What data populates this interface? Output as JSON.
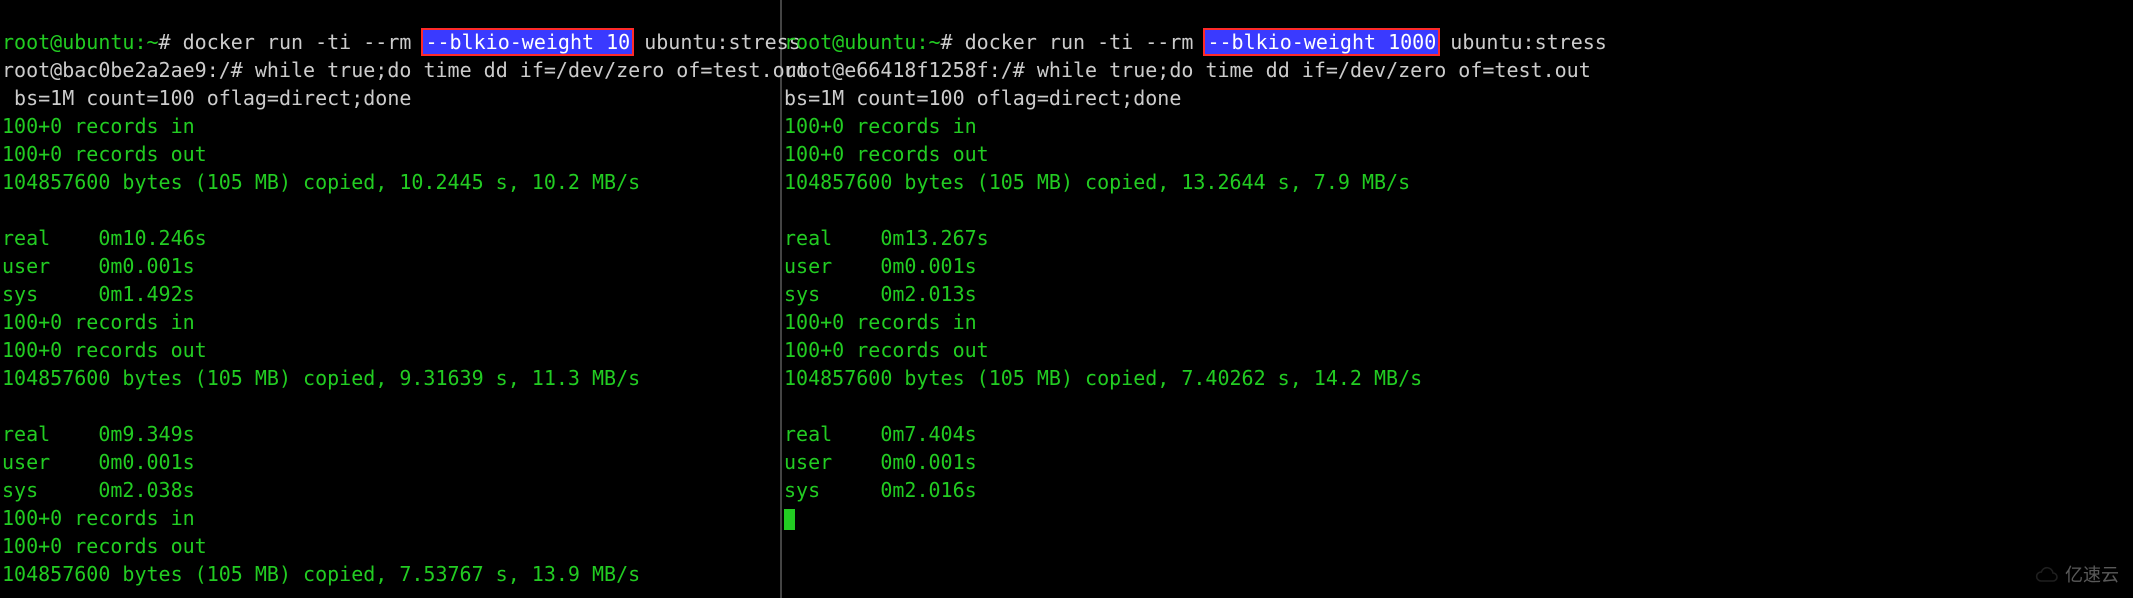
{
  "left": {
    "prompt_host": "root@ubuntu",
    "prompt_path": "~",
    "docker_pre": "docker run -ti --rm ",
    "docker_flag": "--blkio-weight 10",
    "docker_post": " ubuntu:stress",
    "inner_prompt": "root@bac0be2a2ae9:/# ",
    "inner_cmd": "while true;do time dd if=/dev/zero of=test.out\n bs=1M count=100 oflag=direct;done",
    "runs": [
      {
        "rec_in": "100+0 records in",
        "rec_out": "100+0 records out",
        "copied": "104857600 bytes (105 MB) copied, 10.2445 s, 10.2 MB/s",
        "real": "real    0m10.246s",
        "user": "user    0m0.001s",
        "sys": "sys     0m1.492s"
      },
      {
        "rec_in": "100+0 records in",
        "rec_out": "100+0 records out",
        "copied": "104857600 bytes (105 MB) copied, 9.31639 s, 11.3 MB/s",
        "real": "real    0m9.349s",
        "user": "user    0m0.001s",
        "sys": "sys     0m2.038s"
      },
      {
        "rec_in": "100+0 records in",
        "rec_out": "100+0 records out",
        "copied": "104857600 bytes (105 MB) copied, 7.53767 s, 13.9 MB/s"
      }
    ]
  },
  "right": {
    "prompt_host": "root@ubuntu",
    "prompt_path": "~",
    "docker_pre": "docker run -ti --rm ",
    "docker_flag": "--blkio-weight 1000",
    "docker_post": " ubuntu:stress",
    "inner_prompt": "root@e66418f1258f:/# ",
    "inner_cmd": "while true;do time dd if=/dev/zero of=test.out\nbs=1M count=100 oflag=direct;done",
    "runs": [
      {
        "rec_in": "100+0 records in",
        "rec_out": "100+0 records out",
        "copied": "104857600 bytes (105 MB) copied, 13.2644 s, 7.9 MB/s",
        "real": "real    0m13.267s",
        "user": "user    0m0.001s",
        "sys": "sys     0m2.013s"
      },
      {
        "rec_in": "100+0 records in",
        "rec_out": "100+0 records out",
        "copied": "104857600 bytes (105 MB) copied, 7.40262 s, 14.2 MB/s",
        "real": "real    0m7.404s",
        "user": "user    0m0.001s",
        "sys": "sys     0m2.016s"
      }
    ]
  },
  "watermark": "亿速云"
}
